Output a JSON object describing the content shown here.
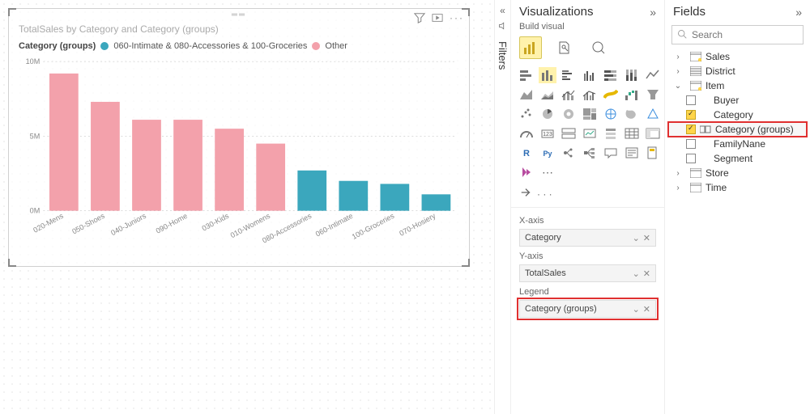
{
  "chart": {
    "title": "TotalSales by Category and Category (groups)",
    "legend_label": "Category (groups)",
    "legend_items": [
      {
        "label": "060-Intimate & 080-Accessories & 100-Groceries",
        "color": "#3ba7bd"
      },
      {
        "label": "Other",
        "color": "#f3a1ab"
      }
    ]
  },
  "chart_data": {
    "type": "bar",
    "title": "TotalSales by Category and Category (groups)",
    "xlabel": "",
    "ylabel": "",
    "ylim": [
      0,
      10000000
    ],
    "yticks": [
      0,
      5000000,
      10000000
    ],
    "ytick_labels": [
      "0M",
      "5M",
      "10M"
    ],
    "categories": [
      "020-Mens",
      "050-Shoes",
      "040-Juniors",
      "090-Home",
      "030-Kids",
      "010-Womens",
      "080-Accessories",
      "060-Intimate",
      "100-Groceries",
      "070-Hosiery"
    ],
    "series": [
      {
        "name": "Other",
        "color": "#f3a1ab",
        "values": [
          9200000,
          7300000,
          6100000,
          6100000,
          5500000,
          4500000,
          null,
          null,
          null,
          null
        ]
      },
      {
        "name": "060-Intimate & 080-Accessories & 100-Groceries",
        "color": "#3ba7bd",
        "values": [
          null,
          null,
          null,
          null,
          null,
          null,
          2700000,
          2000000,
          1800000,
          1100000
        ]
      }
    ]
  },
  "filters_label": "Filters",
  "viz": {
    "title": "Visualizations",
    "sub": "Build visual",
    "wells": {
      "xaxis_label": "X-axis",
      "xaxis_value": "Category",
      "yaxis_label": "Y-axis",
      "yaxis_value": "TotalSales",
      "legend_label": "Legend",
      "legend_value": "Category (groups)"
    }
  },
  "fields": {
    "title": "Fields",
    "search_placeholder": "Search",
    "tables": {
      "sales": "Sales",
      "district": "District",
      "item": "Item",
      "store": "Store",
      "time": "Time"
    },
    "item_fields": {
      "buyer": "Buyer",
      "category": "Category",
      "category_groups": "Category (groups)",
      "familyname": "FamilyNane",
      "segment": "Segment"
    }
  }
}
